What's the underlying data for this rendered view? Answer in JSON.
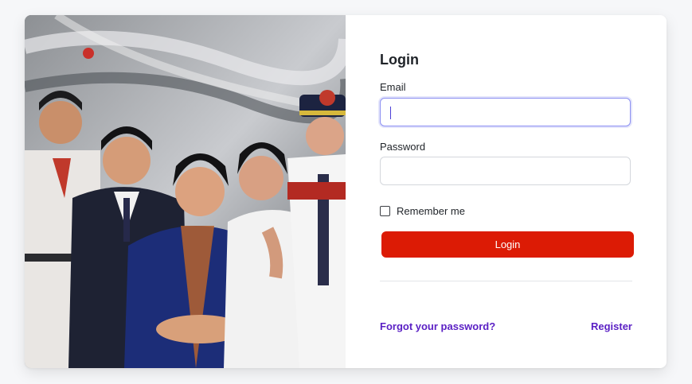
{
  "hero": {
    "icon": "crew-photo-image"
  },
  "form": {
    "title": "Login",
    "email_label": "Email",
    "email_value": "",
    "password_label": "Password",
    "password_value": "",
    "remember_label": "Remember me",
    "remember_checked": false,
    "submit_label": "Login"
  },
  "links": {
    "forgot_label": "Forgot your password?",
    "register_label": "Register"
  },
  "colors": {
    "accent": "#dc1b05",
    "link": "#5a1fc4",
    "focus": "#8b8ff2"
  }
}
